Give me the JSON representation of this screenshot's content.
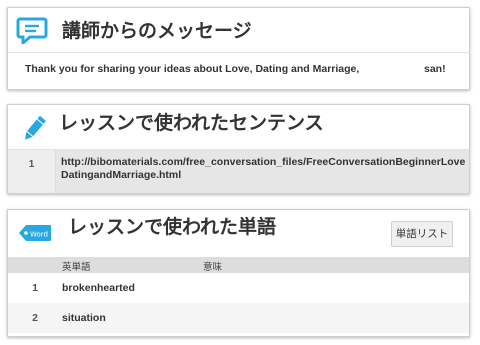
{
  "teacher_message": {
    "title": "講師からのメッセージ",
    "icon": "message-icon",
    "text": "Thank you for sharing your ideas about Love, Dating and Marriage,",
    "suffix": "san!"
  },
  "lesson_sentences": {
    "title": "レッスンで使われたセンテンス",
    "icon": "pencil-icon",
    "rows": [
      {
        "number": "1",
        "text": "http://bibomaterials.com/free_conversation_files/FreeConversationBeginnerLoveDatingandMarriage.html"
      }
    ]
  },
  "lesson_words": {
    "title": "レッスンで使われた単語",
    "icon": "tag-icon",
    "tag_text": "Word",
    "list_button": "単語リスト",
    "columns": {
      "word": "英単語",
      "meaning": "意味"
    },
    "rows": [
      {
        "number": "1",
        "word": "brokenhearted",
        "meaning": ""
      },
      {
        "number": "2",
        "word": "situation",
        "meaning": ""
      }
    ]
  },
  "colors": {
    "accent": "#29a8e0",
    "header_row": "#dddddd"
  }
}
